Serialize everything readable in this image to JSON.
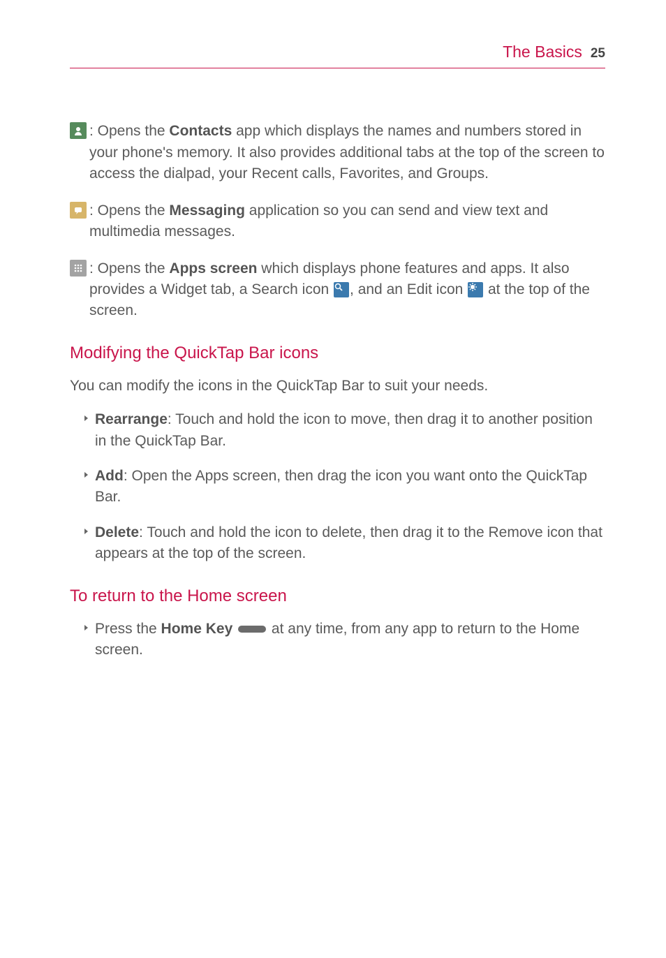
{
  "header": {
    "title": "The Basics",
    "page": "25"
  },
  "items": {
    "contacts": {
      "pre": ": Opens the ",
      "bold": "Contacts",
      "post": " app which displays the names and numbers stored in your phone's memory. It also provides additional tabs at the top of the screen to access the dialpad, your Recent calls, Favorites, and Groups."
    },
    "messaging": {
      "pre": ": Opens the ",
      "bold": "Messaging",
      "post": " application so you can send and view text and multimedia messages."
    },
    "apps": {
      "pre": ": Opens the ",
      "bold": "Apps screen",
      "mid1": " which displays phone features and apps. It also provides a Widget tab, a Search icon ",
      "mid2": ", and an Edit icon ",
      "post": " at the top of the screen."
    }
  },
  "section1": {
    "heading": "Modifying the QuickTap Bar icons",
    "intro": "You can modify the icons in the QuickTap Bar to suit your needs.",
    "bullets": {
      "rearrange": {
        "bold": "Rearrange",
        "text": ": Touch and hold the icon to move, then drag it to another position in the QuickTap Bar."
      },
      "add": {
        "bold": "Add",
        "text": ": Open the Apps screen, then drag the icon you want onto the QuickTap Bar."
      },
      "delete": {
        "bold": "Delete",
        "text": ": Touch and hold the icon to delete, then drag it to the Remove icon that appears at the top of the screen."
      }
    }
  },
  "section2": {
    "heading": "To return to the Home screen",
    "bullet": {
      "pre": "Press the ",
      "bold": "Home Key",
      "post": " at any time, from any app to return to the Home screen."
    }
  }
}
